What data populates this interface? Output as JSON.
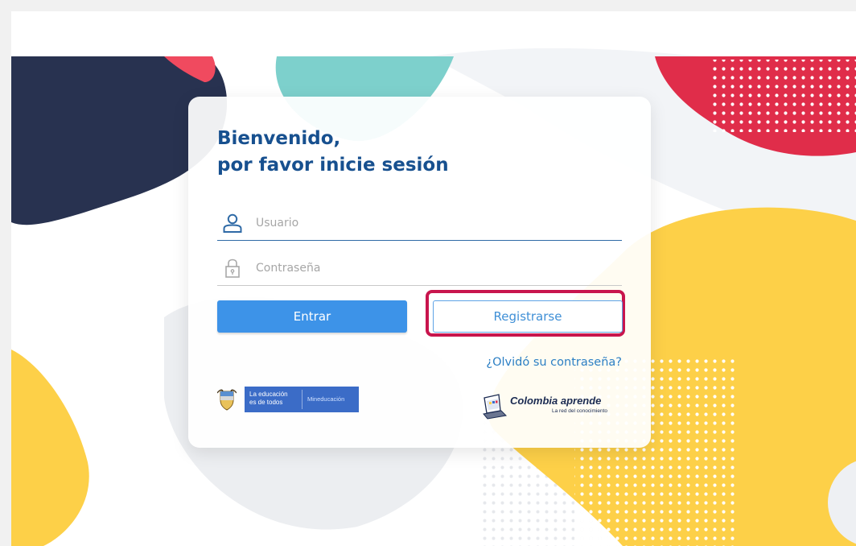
{
  "login": {
    "title_line1": "Bienvenido,",
    "title_line2": "por favor inicie sesión",
    "username_placeholder": "Usuario",
    "password_placeholder": "Contraseña",
    "login_button": "Entrar",
    "register_button": "Registrarse",
    "forgot_link": "¿Olvidó su contraseña?"
  },
  "logos": {
    "mineducacion": {
      "tagline_line1": "La educación",
      "tagline_line2": "es de todos",
      "name": "Mineducación"
    },
    "colombia_aprende": {
      "name": "Colombia aprende",
      "subtitle": "La red del conocimiento"
    }
  },
  "icons": {
    "username": "user-icon",
    "password": "lock-icon",
    "crest": "colombia-crest-icon",
    "laptop": "laptop-icon"
  },
  "colors": {
    "title": "#17508f",
    "primary_button": "#3d93e8",
    "secondary_border": "#5ea3e6",
    "highlight": "#c8154d",
    "link": "#2c7fc4",
    "blob_navy": "#283250",
    "blob_teal": "#7dd0cc",
    "blob_yellow": "#fdd048",
    "blob_red": "#e02d4a"
  }
}
